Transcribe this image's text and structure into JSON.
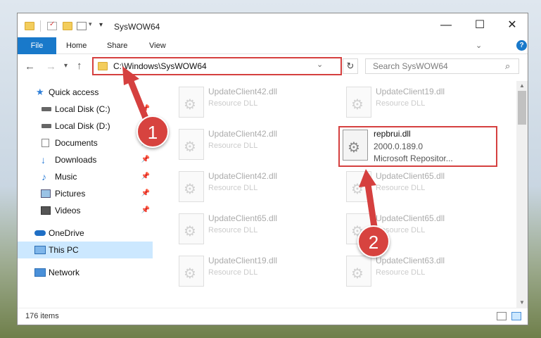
{
  "window": {
    "title": "SysWOW64",
    "controls": {
      "minimize": "—",
      "maximize": "☐",
      "close": "✕"
    }
  },
  "ribbon": {
    "tabs": [
      "File",
      "Home",
      "Share",
      "View"
    ],
    "help": "?"
  },
  "address": {
    "path": "C:\\Windows\\SysWOW64",
    "search_placeholder": "Search SysWOW64"
  },
  "sidebar": {
    "items": [
      {
        "label": "Quick access",
        "icon": "star-icon"
      },
      {
        "label": "Local Disk (C:)",
        "icon": "drive-icon"
      },
      {
        "label": "Local Disk (D:)",
        "icon": "drive-icon"
      },
      {
        "label": "Documents",
        "icon": "documents-icon"
      },
      {
        "label": "Downloads",
        "icon": "download-icon"
      },
      {
        "label": "Music",
        "icon": "music-icon"
      },
      {
        "label": "Pictures",
        "icon": "pictures-icon"
      },
      {
        "label": "Videos",
        "icon": "videos-icon"
      },
      {
        "label": "OneDrive",
        "icon": "cloud-icon"
      },
      {
        "label": "This PC",
        "icon": "computer-icon"
      },
      {
        "label": "Network",
        "icon": "network-icon"
      }
    ]
  },
  "files": [
    {
      "name": "UpdateClient42.dll",
      "type": "Resource DLL"
    },
    {
      "name": "UpdateClient19.dll",
      "type": "Resource DLL"
    },
    {
      "name": "UpdateClient42.dll",
      "type": "Resource DLL"
    },
    {
      "name": "UpdateClient42.dll",
      "type": "Resource DLL"
    },
    {
      "name": "UpdateClient65.dll",
      "type": "Resource DLL"
    },
    {
      "name": "UpdateClient65.dll",
      "type": "Resource DLL"
    },
    {
      "name": "UpdateClient65.dll",
      "type": "Resource DLL"
    },
    {
      "name": "UpdateClient19.dll",
      "type": "Resource DLL"
    },
    {
      "name": "UpdateClient63.dll",
      "type": "Resource DLL"
    }
  ],
  "highlighted_file": {
    "name": "repbrui.dll",
    "version": "2000.0.189.0",
    "company": "Microsoft Repositor..."
  },
  "status": {
    "count": "176 items"
  },
  "annotations": {
    "step1": "1",
    "step2": "2",
    "color": "#d5403f"
  }
}
